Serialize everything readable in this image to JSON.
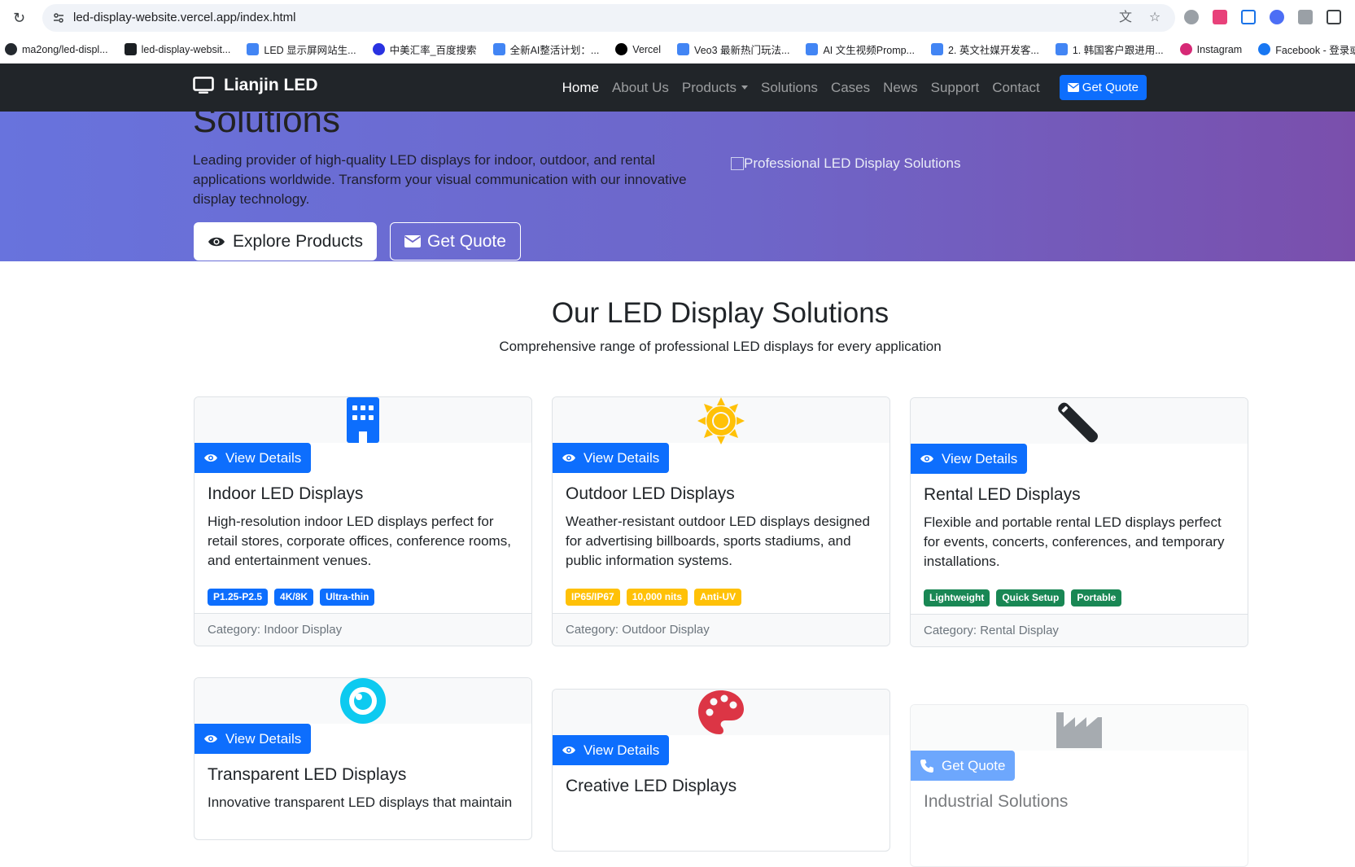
{
  "browser": {
    "url": "led-display-website.vercel.app/index.html",
    "bookmarks": [
      {
        "label": "ma2ong/led-displ...",
        "icon": "github-icon",
        "color": "#24292f"
      },
      {
        "label": "led-display-websit...",
        "icon": "bolt-icon",
        "color": "#1b1f23"
      },
      {
        "label": "LED 显示屏网站生...",
        "icon": "doc-icon",
        "color": "#4285f4"
      },
      {
        "label": "中美汇率_百度搜索",
        "icon": "baidu-icon",
        "color": "#2932e1"
      },
      {
        "label": "全新AI整活计划：...",
        "icon": "doc-icon",
        "color": "#4285f4"
      },
      {
        "label": "Vercel",
        "icon": "vercel-icon",
        "color": "#000000"
      },
      {
        "label": "Veo3 最新热门玩法...",
        "icon": "doc-icon",
        "color": "#4285f4"
      },
      {
        "label": "AI 文生视频Promp...",
        "icon": "doc-icon",
        "color": "#4285f4"
      },
      {
        "label": "2. 英文社媒开发客...",
        "icon": "doc-icon",
        "color": "#4285f4"
      },
      {
        "label": "1. 韩国客户跟进用...",
        "icon": "doc-icon",
        "color": "#4285f4"
      },
      {
        "label": "Instagram",
        "icon": "instagram-icon",
        "color": "#d62976"
      },
      {
        "label": "Facebook - 登录或...",
        "icon": "facebook-icon",
        "color": "#1877f2"
      }
    ]
  },
  "navbar": {
    "brand": "Lianjin LED",
    "links": [
      "Home",
      "About Us",
      "Products",
      "Solutions",
      "Cases",
      "News",
      "Support",
      "Contact"
    ],
    "quote_label": "Get Quote"
  },
  "hero": {
    "title": "Solutions",
    "text": "Leading provider of high-quality LED displays for indoor, outdoor, and rental applications worldwide. Transform your visual communication with our innovative display technology.",
    "image_alt": "Professional LED Display Solutions",
    "explore_label": "Explore Products",
    "quote_label": "Get Quote"
  },
  "section": {
    "title": "Our LED Display Solutions",
    "subtitle": "Comprehensive range of professional LED displays for every application"
  },
  "cards": [
    {
      "icon": "building-icon",
      "icon_color": "#0d6efd",
      "button": "View Details",
      "title": "Indoor LED Displays",
      "text": "High-resolution indoor LED displays perfect for retail stores, corporate offices, conference rooms, and entertainment venues.",
      "badges": [
        "P1.25-P2.5",
        "4K/8K",
        "Ultra-thin"
      ],
      "badge_color": "blue",
      "footer": "Category: Indoor Display"
    },
    {
      "icon": "sun-icon",
      "icon_color": "#ffc107",
      "button": "View Details",
      "title": "Outdoor LED Displays",
      "text": "Weather-resistant outdoor LED displays designed for advertising billboards, sports stadiums, and public information systems.",
      "badges": [
        "IP65/IP67",
        "10,000 nits",
        "Anti-UV"
      ],
      "badge_color": "yellow",
      "footer": "Category: Outdoor Display"
    },
    {
      "icon": "tool-icon",
      "icon_color": "#212529",
      "button": "View Details",
      "title": "Rental LED Displays",
      "text": "Flexible and portable rental LED displays perfect for events, concerts, conferences, and temporary installations.",
      "badges": [
        "Lightweight",
        "Quick Setup",
        "Portable"
      ],
      "badge_color": "green",
      "footer": "Category: Rental Display"
    },
    {
      "icon": "eye-icon",
      "icon_color": "#0dcaf0",
      "button": "View Details",
      "title": "Transparent LED Displays",
      "text": "Innovative transparent LED displays that maintain"
    },
    {
      "icon": "palette-icon",
      "icon_color": "#dc3545",
      "button": "View Details",
      "title": "Creative LED Displays"
    },
    {
      "icon": "factory-icon",
      "icon_color": "#6c757d",
      "button": "Get Quote",
      "title": "Industrial Solutions"
    }
  ]
}
